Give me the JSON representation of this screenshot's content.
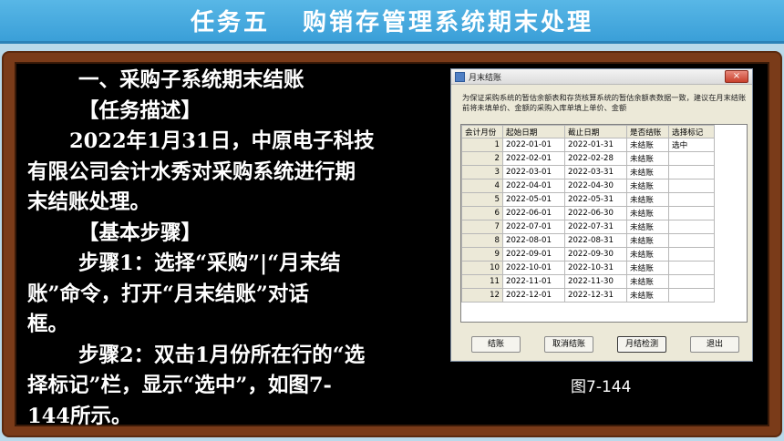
{
  "slide": {
    "title_part1": "任务五",
    "title_part2": "购销存管理系统期末处理",
    "lines": [
      "一、采购子系统期末结账",
      "【任务描述】",
      "2022年1月31日，中原电子科技",
      "有限公司会计水秀对采购系统进行期",
      "末结账处理。",
      "【基本步骤】",
      "步骤1：选择“采购”|“月末结",
      "账”命令，打开“月末结账”对话",
      "框。",
      "步骤2：双击1月份所在行的“选",
      "择标记”栏，显示“选中”，如图7-",
      "144所示。"
    ],
    "caption": "图7-144"
  },
  "dialog": {
    "title": "月末结账",
    "close": "×",
    "note": "为保证采购系统的暂估余额表和存货核算系统的暂估余额表数据一致，建议在月末结账前将未填单价、金额的采购入库单填上单价、金额",
    "headers": [
      "会计月份",
      "起始日期",
      "截止日期",
      "是否结账",
      "选择标记"
    ],
    "rows": [
      [
        "1",
        "2022-01-01",
        "2022-01-31",
        "未结账",
        "选中"
      ],
      [
        "2",
        "2022-02-01",
        "2022-02-28",
        "未结账",
        ""
      ],
      [
        "3",
        "2022-03-01",
        "2022-03-31",
        "未结账",
        ""
      ],
      [
        "4",
        "2022-04-01",
        "2022-04-30",
        "未结账",
        ""
      ],
      [
        "5",
        "2022-05-01",
        "2022-05-31",
        "未结账",
        ""
      ],
      [
        "6",
        "2022-06-01",
        "2022-06-30",
        "未结账",
        ""
      ],
      [
        "7",
        "2022-07-01",
        "2022-07-31",
        "未结账",
        ""
      ],
      [
        "8",
        "2022-08-01",
        "2022-08-31",
        "未结账",
        ""
      ],
      [
        "9",
        "2022-09-01",
        "2022-09-30",
        "未结账",
        ""
      ],
      [
        "10",
        "2022-10-01",
        "2022-10-31",
        "未结账",
        ""
      ],
      [
        "11",
        "2022-11-01",
        "2022-11-30",
        "未结账",
        ""
      ],
      [
        "12",
        "2022-12-01",
        "2022-12-31",
        "未结账",
        ""
      ]
    ],
    "buttons": [
      "结账",
      "取消结账",
      "月结检测",
      "退出"
    ]
  }
}
